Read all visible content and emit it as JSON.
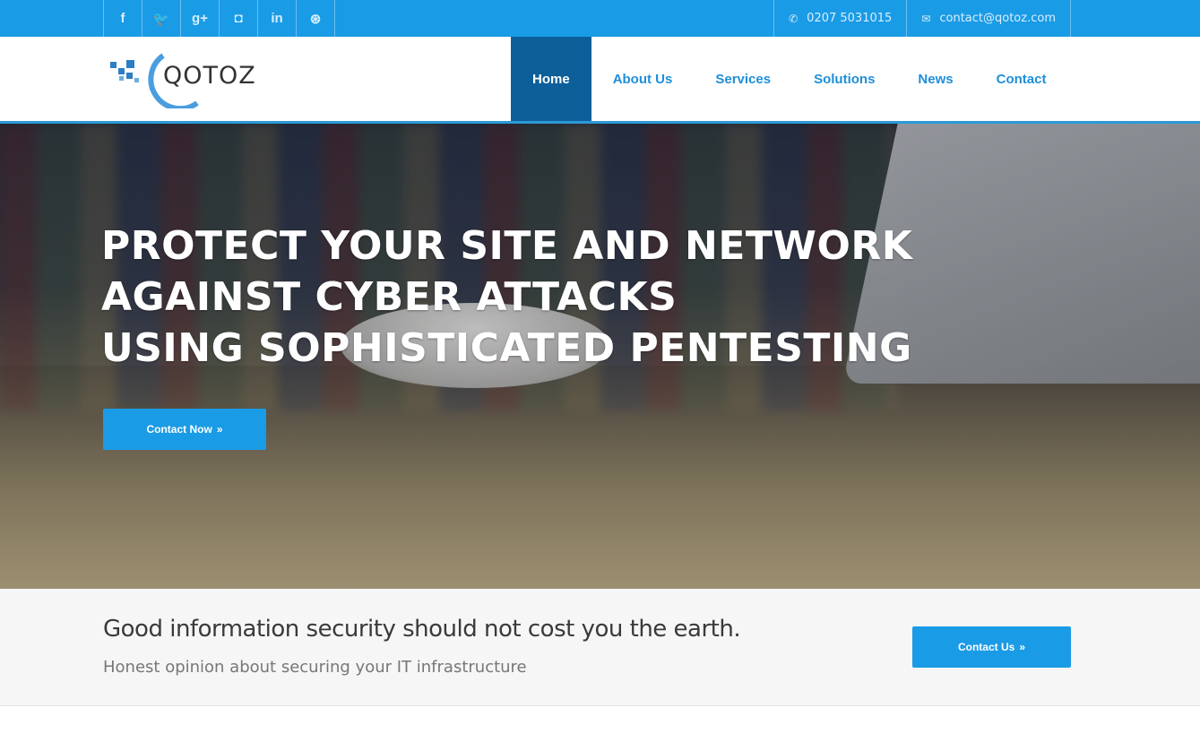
{
  "topbar": {
    "social": [
      {
        "icon": "facebook-icon",
        "glyph": "f"
      },
      {
        "icon": "twitter-icon",
        "glyph": "🐦"
      },
      {
        "icon": "google-plus-icon",
        "glyph": "g+"
      },
      {
        "icon": "instagram-icon",
        "glyph": "◘"
      },
      {
        "icon": "linkedin-icon",
        "glyph": "in"
      },
      {
        "icon": "dribbble-icon",
        "glyph": "⊛"
      }
    ],
    "phone": "0207 5031015",
    "email": "contact@qotoz.com"
  },
  "brand": {
    "name": "QOTOZ"
  },
  "nav": [
    {
      "label": "Home",
      "active": true
    },
    {
      "label": "About Us"
    },
    {
      "label": "Services"
    },
    {
      "label": "Solutions"
    },
    {
      "label": "News"
    },
    {
      "label": "Contact"
    }
  ],
  "hero": {
    "lines": [
      "PROTECT YOUR SITE AND NETWORK",
      "AGAINST CYBER ATTACKS",
      "USING SOPHISTICATED PENTESTING"
    ],
    "button_label": "Contact Now",
    "button_icon": "»"
  },
  "cta": {
    "headline": "Good information security should not cost you the earth.",
    "subline": "Honest opinion about securing your IT infrastructure",
    "button_label": "Contact Us",
    "button_icon": "»"
  },
  "colors": {
    "accent": "#1a9be6",
    "nav_active": "#0d5f99",
    "nav_text": "#1f8fd8"
  }
}
